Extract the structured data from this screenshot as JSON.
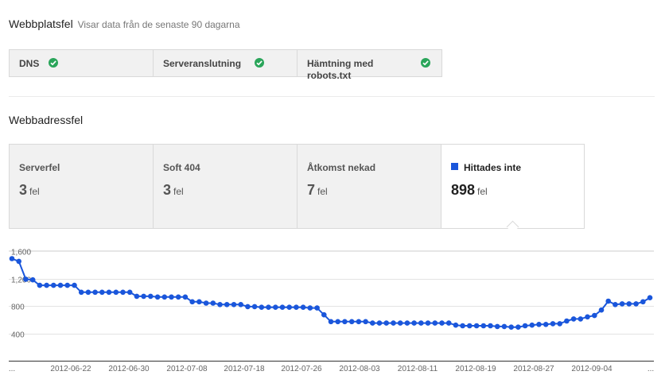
{
  "site_errors": {
    "title": "Webbplatsfel",
    "subtitle": "Visar data från de senaste 90 dagarna",
    "items": [
      {
        "label": "DNS"
      },
      {
        "label": "Serveranslutning"
      },
      {
        "label": "Hämtning med robots.txt"
      }
    ]
  },
  "url_errors": {
    "title": "Webbadressfel",
    "tiles": [
      {
        "label": "Serverfel",
        "count": "3",
        "unit": "fel",
        "selected": false
      },
      {
        "label": "Soft 404",
        "count": "3",
        "unit": "fel",
        "selected": false
      },
      {
        "label": "Åtkomst nekad",
        "count": "7",
        "unit": "fel",
        "selected": false
      },
      {
        "label": "Hittades inte",
        "count": "898",
        "unit": "fel",
        "selected": true
      }
    ]
  },
  "colors": {
    "series": "#1a56db",
    "check": "#2aa55a"
  },
  "chart_data": {
    "type": "line",
    "series": [
      {
        "name": "Hittades inte",
        "values": [
          1490,
          1450,
          1190,
          1180,
          1100,
          1100,
          1100,
          1100,
          1100,
          1100,
          1000,
          1000,
          1000,
          1000,
          1000,
          1000,
          1000,
          1000,
          940,
          940,
          940,
          930,
          930,
          930,
          930,
          930,
          860,
          860,
          840,
          840,
          820,
          820,
          820,
          820,
          790,
          790,
          780,
          780,
          780,
          780,
          780,
          780,
          780,
          770,
          770,
          670,
          570,
          570,
          570,
          570,
          570,
          570,
          550,
          550,
          550,
          550,
          550,
          550,
          550,
          550,
          550,
          550,
          550,
          550,
          520,
          510,
          510,
          510,
          510,
          510,
          500,
          500,
          490,
          490,
          510,
          520,
          530,
          530,
          540,
          540,
          580,
          610,
          610,
          640,
          660,
          740,
          870,
          820,
          830,
          830,
          830,
          860,
          920
        ]
      }
    ],
    "x_tick_labels": [
      "...",
      "2012-06-22",
      "2012-06-30",
      "2012-07-08",
      "2012-07-18",
      "2012-07-26",
      "2012-08-03",
      "2012-08-11",
      "2012-08-19",
      "2012-08-27",
      "2012-09-04",
      "..."
    ],
    "y_tick_labels": [
      "1,600",
      "1,200",
      "800",
      "400"
    ],
    "y_ticks": [
      1600,
      1200,
      800,
      400
    ],
    "ylim": [
      0,
      1600
    ],
    "grid": true
  }
}
